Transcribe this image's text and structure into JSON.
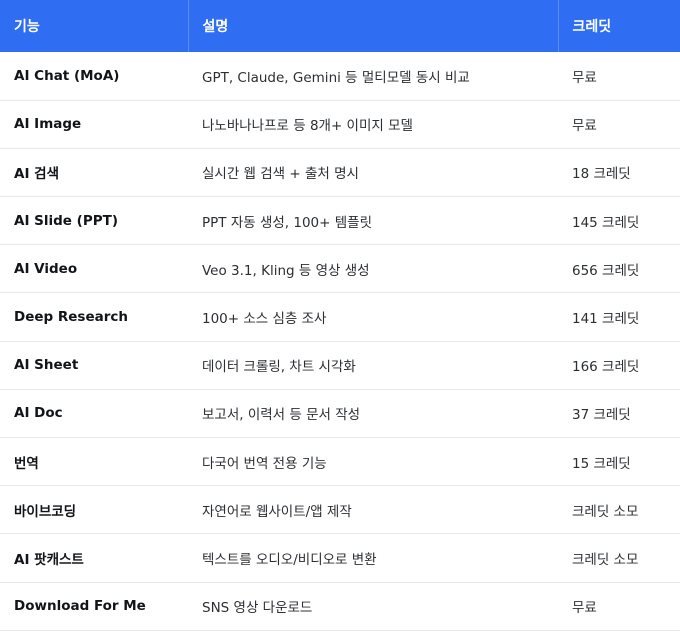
{
  "table": {
    "headers": [
      "기능",
      "설명",
      "크레딧"
    ],
    "rows": [
      [
        "AI Chat (MoA)",
        "GPT, Claude, Gemini 등 멀티모델 동시 비교",
        "무료"
      ],
      [
        "AI Image",
        "나노바나나프로 등 8개+ 이미지 모델",
        "무료"
      ],
      [
        "AI 검색",
        "실시간 웹 검색 + 출처 명시",
        "18 크레딧"
      ],
      [
        "AI Slide (PPT)",
        "PPT 자동 생성, 100+ 템플릿",
        "145 크레딧"
      ],
      [
        "AI Video",
        "Veo 3.1, Kling 등 영상 생성",
        "656 크레딧"
      ],
      [
        "Deep Research",
        "100+ 소스 심층 조사",
        "141 크레딧"
      ],
      [
        "AI Sheet",
        "데이터 크롤링, 차트 시각화",
        "166 크레딧"
      ],
      [
        "AI Doc",
        "보고서, 이력서 등 문서 작성",
        "37 크레딧"
      ],
      [
        "번역",
        "다국어 번역 전용 기능",
        "15 크레딧"
      ],
      [
        "바이브코딩",
        "자연어로 웹사이트/앱 제작",
        "크레딧 소모"
      ],
      [
        "AI 팟캐스트",
        "텍스트를 오디오/비디오로 변환",
        "크레딧 소모"
      ],
      [
        "Download For Me",
        "SNS 영상 다운로드",
        "무료"
      ]
    ]
  },
  "colors": {
    "header_bg": "#2f6ef2",
    "header_text": "#ffffff",
    "row_divider": "#e6e8eb"
  }
}
